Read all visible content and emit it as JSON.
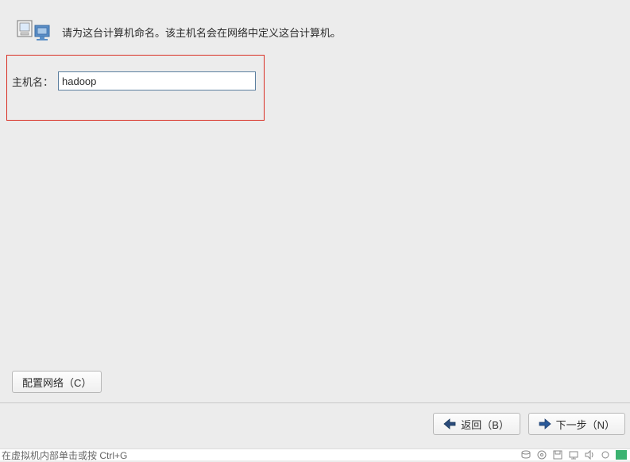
{
  "header": {
    "instruction": "请为这台计算机命名。该主机名会在网络中定义这台计算机。"
  },
  "form": {
    "hostname_label": "主机名：",
    "hostname_value": "hadoop"
  },
  "buttons": {
    "configure_network": "配置网络（C）",
    "back": "返回（B）",
    "next": "下一步（N）"
  },
  "footer": {
    "hint_text": "在虚拟机内部单击或按 Ctrl+G"
  }
}
